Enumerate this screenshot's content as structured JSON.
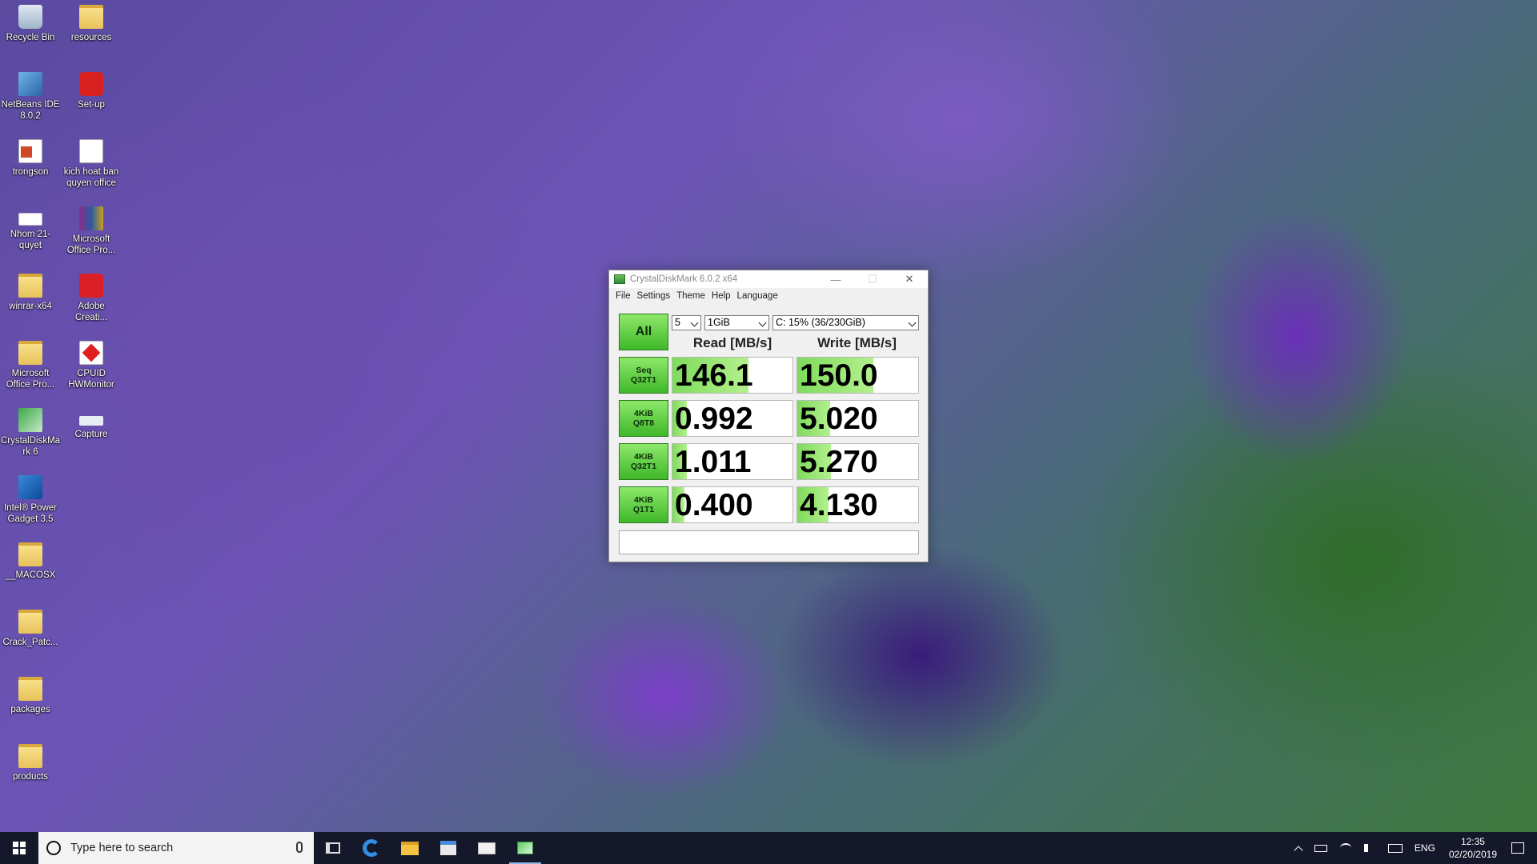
{
  "desktop": {
    "icons": [
      {
        "label": "Recycle Bin",
        "icon": "recycle-bin-icon"
      },
      {
        "label": "resources",
        "icon": "folder-icon"
      },
      {
        "label": "NetBeans IDE 8.0.2",
        "icon": "netbeans-icon"
      },
      {
        "label": "Set-up",
        "icon": "setup-icon"
      },
      {
        "label": "trongson",
        "icon": "powerpoint-icon"
      },
      {
        "label": "kich hoat ban quyen office",
        "icon": "text-document-icon"
      },
      {
        "label": "Nhom 21-quyet",
        "icon": "document-icon"
      },
      {
        "label": "Microsoft Office Pro...",
        "icon": "winrar-archive-icon"
      },
      {
        "label": "winrar-x64",
        "icon": "folder-icon"
      },
      {
        "label": "Adobe Creati...",
        "icon": "adobe-icon"
      },
      {
        "label": "Microsoft Office Pro...",
        "icon": "folder-icon"
      },
      {
        "label": "CPUID HWMonitor",
        "icon": "cpuid-icon"
      },
      {
        "label": "CrystalDiskMark 6",
        "icon": "crystaldiskmark-icon"
      },
      {
        "label": "Capture",
        "icon": "image-icon"
      },
      {
        "label": "Intel® Power Gadget 3.5",
        "icon": "intel-power-gadget-icon"
      },
      {
        "label": "__MACOSX",
        "icon": "folder-icon"
      },
      {
        "label": "Crack_Patc...",
        "icon": "folder-icon"
      },
      {
        "label": "packages",
        "icon": "folder-icon"
      },
      {
        "label": "products",
        "icon": "folder-icon"
      }
    ]
  },
  "window": {
    "title": "CrystalDiskMark 6.0.2 x64",
    "controls": {
      "minimize": "—",
      "maximize": "☐",
      "close": "✕"
    },
    "menu": [
      "File",
      "Settings",
      "Theme",
      "Help",
      "Language"
    ],
    "all_button": "All",
    "selects": {
      "count": "5",
      "size": "1GiB",
      "drive": "C: 15% (36/230GiB)"
    },
    "headers": {
      "read": "Read [MB/s]",
      "write": "Write [MB/s]"
    },
    "rows": [
      {
        "line1": "Seq",
        "line2": "Q32T1",
        "read": "146.1",
        "write": "150.0",
        "read_fill_percent": 63,
        "write_fill_percent": 63
      },
      {
        "line1": "4KiB",
        "line2": "Q8T8",
        "read": "0.992",
        "write": "5.020",
        "read_fill_percent": 12,
        "write_fill_percent": 27
      },
      {
        "line1": "4KiB",
        "line2": "Q32T1",
        "read": "1.011",
        "write": "5.270",
        "read_fill_percent": 12,
        "write_fill_percent": 28
      },
      {
        "line1": "4KiB",
        "line2": "Q1T1",
        "read": "0.400",
        "write": "4.130",
        "read_fill_percent": 10,
        "write_fill_percent": 26
      }
    ],
    "comment": ""
  },
  "taskbar": {
    "search_placeholder": "Type here to search",
    "apps": [
      "task-view-icon",
      "edge-icon",
      "file-explorer-icon",
      "store-icon",
      "mail-icon",
      "crystaldiskmark-icon"
    ],
    "language": "ENG",
    "time": "12:35",
    "date": "02/20/2019"
  },
  "colors": {
    "accent_green": "#3fb82a",
    "bar_green": "#7edb5c",
    "taskbar": "#15182b"
  }
}
